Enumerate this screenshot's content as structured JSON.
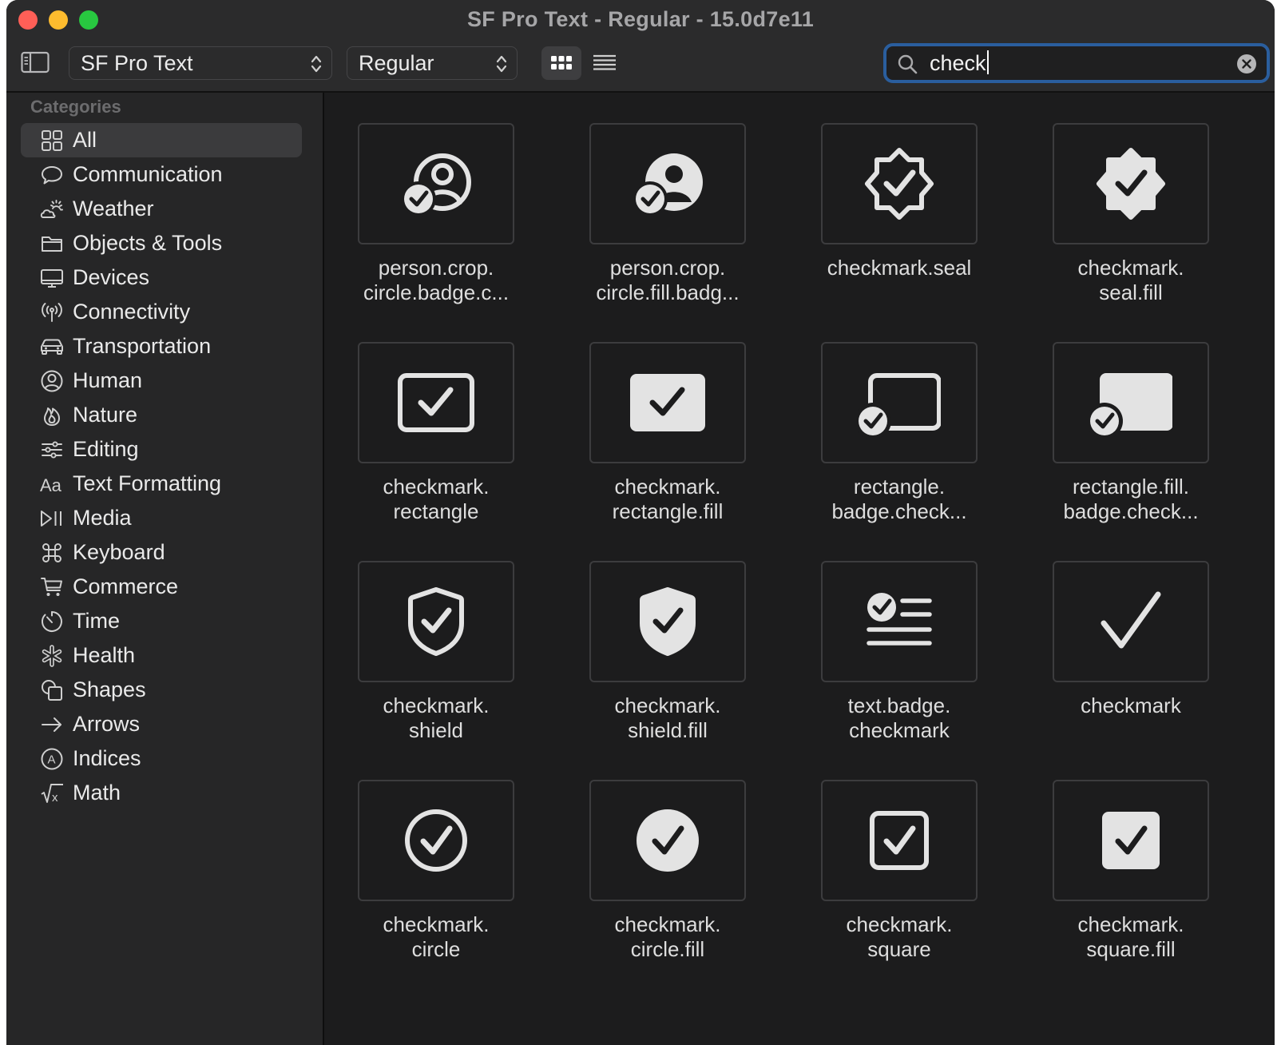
{
  "window": {
    "title": "SF Pro Text - Regular - 15.0d7e11"
  },
  "toolbar": {
    "sidebar_toggle_icon": "sidebar-left-icon",
    "font_family": "SF Pro Text",
    "font_style": "Regular",
    "view_grid_icon": "grid-view-icon",
    "view_list_icon": "list-view-icon",
    "search": {
      "value": "check",
      "icon": "magnifyingglass-icon",
      "clear_icon": "clear-icon"
    }
  },
  "sidebar": {
    "header": "Categories",
    "items": [
      {
        "label": "All",
        "icon": "square-grid-icon",
        "selected": true
      },
      {
        "label": "Communication",
        "icon": "speech-bubble-icon"
      },
      {
        "label": "Weather",
        "icon": "cloud-sun-icon"
      },
      {
        "label": "Objects & Tools",
        "icon": "folder-icon"
      },
      {
        "label": "Devices",
        "icon": "desktop-icon"
      },
      {
        "label": "Connectivity",
        "icon": "antenna-icon"
      },
      {
        "label": "Transportation",
        "icon": "car-icon"
      },
      {
        "label": "Human",
        "icon": "person-circle-icon"
      },
      {
        "label": "Nature",
        "icon": "flame-icon"
      },
      {
        "label": "Editing",
        "icon": "sliders-icon"
      },
      {
        "label": "Text Formatting",
        "icon": "textformat-icon"
      },
      {
        "label": "Media",
        "icon": "play-pause-icon"
      },
      {
        "label": "Keyboard",
        "icon": "command-icon"
      },
      {
        "label": "Commerce",
        "icon": "cart-icon"
      },
      {
        "label": "Time",
        "icon": "timer-icon"
      },
      {
        "label": "Health",
        "icon": "asterisk-icon"
      },
      {
        "label": "Shapes",
        "icon": "shapes-icon"
      },
      {
        "label": "Arrows",
        "icon": "arrow-right-icon"
      },
      {
        "label": "Indices",
        "icon": "a-circle-icon"
      },
      {
        "label": "Math",
        "icon": "sqrt-x-icon"
      }
    ]
  },
  "symbols": [
    {
      "lines": [
        "person.crop.",
        "circle.badge.c..."
      ],
      "icon": "person-crop-circle-badge-checkmark-icon"
    },
    {
      "lines": [
        "person.crop.",
        "circle.fill.badg..."
      ],
      "icon": "person-crop-circle-fill-badge-checkmark-icon"
    },
    {
      "lines": [
        "checkmark.seal"
      ],
      "icon": "checkmark-seal-icon"
    },
    {
      "lines": [
        "checkmark.",
        "seal.fill"
      ],
      "icon": "checkmark-seal-fill-icon"
    },
    {
      "lines": [
        "checkmark.",
        "rectangle"
      ],
      "icon": "checkmark-rectangle-icon"
    },
    {
      "lines": [
        "checkmark.",
        "rectangle.fill"
      ],
      "icon": "checkmark-rectangle-fill-icon"
    },
    {
      "lines": [
        "rectangle.",
        "badge.check..."
      ],
      "icon": "rectangle-badge-checkmark-icon"
    },
    {
      "lines": [
        "rectangle.fill.",
        "badge.check..."
      ],
      "icon": "rectangle-fill-badge-checkmark-icon"
    },
    {
      "lines": [
        "checkmark.",
        "shield"
      ],
      "icon": "checkmark-shield-icon"
    },
    {
      "lines": [
        "checkmark.",
        "shield.fill"
      ],
      "icon": "checkmark-shield-fill-icon"
    },
    {
      "lines": [
        "text.badge.",
        "checkmark"
      ],
      "icon": "text-badge-checkmark-icon"
    },
    {
      "lines": [
        "checkmark"
      ],
      "icon": "checkmark-icon"
    },
    {
      "lines": [
        "checkmark.",
        "circle"
      ],
      "icon": "checkmark-circle-icon"
    },
    {
      "lines": [
        "checkmark.",
        "circle.fill"
      ],
      "icon": "checkmark-circle-fill-icon"
    },
    {
      "lines": [
        "checkmark.",
        "square"
      ],
      "icon": "checkmark-square-icon"
    },
    {
      "lines": [
        "checkmark.",
        "square.fill"
      ],
      "icon": "checkmark-square-fill-icon"
    }
  ],
  "colors": {
    "window_bg": "#1e1e1e",
    "sidebar_bg": "#262627",
    "selection": "#3b3b3d",
    "focus_ring": "#2a5e9e",
    "glyph": "#e3e3e3"
  }
}
